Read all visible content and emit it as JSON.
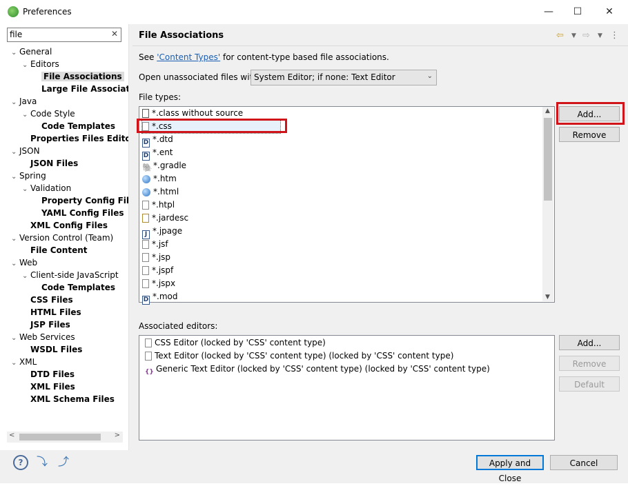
{
  "window": {
    "title": "Preferences",
    "controls": [
      "—",
      "☐",
      "✕"
    ]
  },
  "filter": {
    "value": "file",
    "clear": "✕"
  },
  "tree": [
    {
      "label": "General",
      "level": 0,
      "twisty": "v",
      "bold": false
    },
    {
      "label": "Editors",
      "level": 1,
      "twisty": "v",
      "bold": false
    },
    {
      "label": "File Associations",
      "level": 2,
      "twisty": "",
      "bold": true,
      "selected": true
    },
    {
      "label": "Large File Associati",
      "level": 2,
      "twisty": "",
      "bold": true
    },
    {
      "label": "Java",
      "level": 0,
      "twisty": "v",
      "bold": false
    },
    {
      "label": "Code Style",
      "level": 1,
      "twisty": "v",
      "bold": false
    },
    {
      "label": "Code Templates",
      "level": 2,
      "twisty": "",
      "bold": true
    },
    {
      "label": "Properties Files Editor",
      "level": 1,
      "twisty": "",
      "bold": true
    },
    {
      "label": "JSON",
      "level": 0,
      "twisty": "v",
      "bold": false
    },
    {
      "label": "JSON Files",
      "level": 1,
      "twisty": "",
      "bold": true
    },
    {
      "label": "Spring",
      "level": 0,
      "twisty": "v",
      "bold": false
    },
    {
      "label": "Validation",
      "level": 1,
      "twisty": "v",
      "bold": false
    },
    {
      "label": "Property Config File",
      "level": 2,
      "twisty": "",
      "bold": true
    },
    {
      "label": "YAML Config Files",
      "level": 2,
      "twisty": "",
      "bold": true
    },
    {
      "label": "XML Config Files",
      "level": 1,
      "twisty": "",
      "bold": true
    },
    {
      "label": "Version Control (Team)",
      "level": 0,
      "twisty": "v",
      "bold": false
    },
    {
      "label": "File Content",
      "level": 1,
      "twisty": "",
      "bold": true
    },
    {
      "label": "Web",
      "level": 0,
      "twisty": "v",
      "bold": false
    },
    {
      "label": "Client-side JavaScript",
      "level": 1,
      "twisty": "v",
      "bold": false
    },
    {
      "label": "Code Templates",
      "level": 2,
      "twisty": "",
      "bold": true
    },
    {
      "label": "CSS Files",
      "level": 1,
      "twisty": "",
      "bold": true
    },
    {
      "label": "HTML Files",
      "level": 1,
      "twisty": "",
      "bold": true
    },
    {
      "label": "JSP Files",
      "level": 1,
      "twisty": "",
      "bold": true
    },
    {
      "label": "Web Services",
      "level": 0,
      "twisty": "v",
      "bold": false
    },
    {
      "label": "WSDL Files",
      "level": 1,
      "twisty": "",
      "bold": true
    },
    {
      "label": "XML",
      "level": 0,
      "twisty": "v",
      "bold": false
    },
    {
      "label": "DTD Files",
      "level": 1,
      "twisty": "",
      "bold": true
    },
    {
      "label": "XML Files",
      "level": 1,
      "twisty": "",
      "bold": true
    },
    {
      "label": "XML Schema Files",
      "level": 1,
      "twisty": "",
      "bold": true
    }
  ],
  "page": {
    "title": "File Associations",
    "see_prefix": "See ",
    "see_link": "'Content Types'",
    "see_suffix": " for content-type based file associations.",
    "open_label": "Open unassociated files with:",
    "open_value": "System Editor; if none: Text Editor",
    "file_types_label": "File types:",
    "associated_label": "Associated editors:"
  },
  "file_types": [
    {
      "label": "*.class without source",
      "icon": "class-file-icon"
    },
    {
      "label": "*.css",
      "icon": "text-file-icon",
      "selected": true
    },
    {
      "label": "*.dtd",
      "icon": "dtd-file-icon"
    },
    {
      "label": "*.ent",
      "icon": "dtd-file-icon"
    },
    {
      "label": "*.gradle",
      "icon": "gradle-icon"
    },
    {
      "label": "*.htm",
      "icon": "globe-icon"
    },
    {
      "label": "*.html",
      "icon": "globe-icon"
    },
    {
      "label": "*.htpl",
      "icon": "text-file-icon"
    },
    {
      "label": "*.jardesc",
      "icon": "jardesc-icon"
    },
    {
      "label": "*.jpage",
      "icon": "jpage-icon"
    },
    {
      "label": "*.jsf",
      "icon": "text-file-icon"
    },
    {
      "label": "*.jsp",
      "icon": "text-file-icon"
    },
    {
      "label": "*.jspf",
      "icon": "text-file-icon"
    },
    {
      "label": "*.jspx",
      "icon": "text-file-icon"
    },
    {
      "label": "*.mod",
      "icon": "dtd-file-icon"
    }
  ],
  "editors": [
    {
      "label": "CSS Editor (locked by 'CSS' content type)",
      "icon": "text-file-icon"
    },
    {
      "label": "Text Editor (locked by 'CSS' content type) (locked by 'CSS' content type)",
      "icon": "text-file-icon"
    },
    {
      "label": "Generic Text Editor (locked by 'CSS' content type) (locked by 'CSS' content type)",
      "icon": "generic-editor-icon"
    }
  ],
  "buttons": {
    "types_add": "Add...",
    "types_remove": "Remove",
    "editors_add": "Add...",
    "editors_remove": "Remove",
    "editors_default": "Default",
    "apply_close": "Apply and Close",
    "cancel": "Cancel"
  },
  "colors": {
    "highlight": "#d1141a",
    "link": "#1a5fb4"
  }
}
